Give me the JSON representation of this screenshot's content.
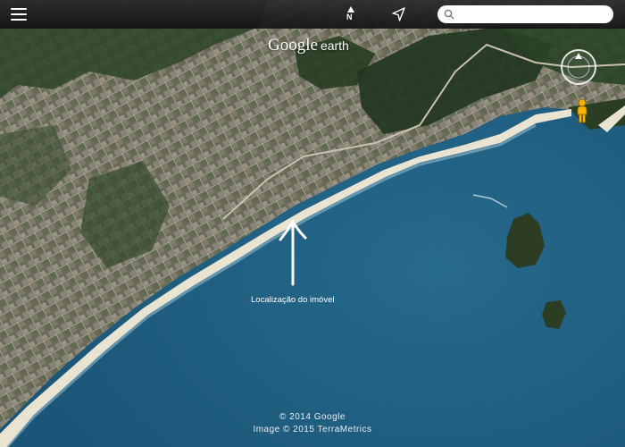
{
  "toolbar": {
    "menu_icon": "menu-icon",
    "north_icon": "north-arrow-icon",
    "north_label": "N",
    "location_icon": "navigation-arrow-icon",
    "search_value": "",
    "search_placeholder": ""
  },
  "brand": {
    "google": "Google",
    "earth": "earth"
  },
  "annotation": {
    "label": "Localização do imóvel"
  },
  "attribution": {
    "line1": "© 2014 Google",
    "line2": "Image © 2015 TerraMetrics"
  },
  "colors": {
    "ocean": "#1f5f82",
    "land": "#4a5a3c",
    "beach": "#e9e3d2",
    "forest": "#22361f"
  }
}
